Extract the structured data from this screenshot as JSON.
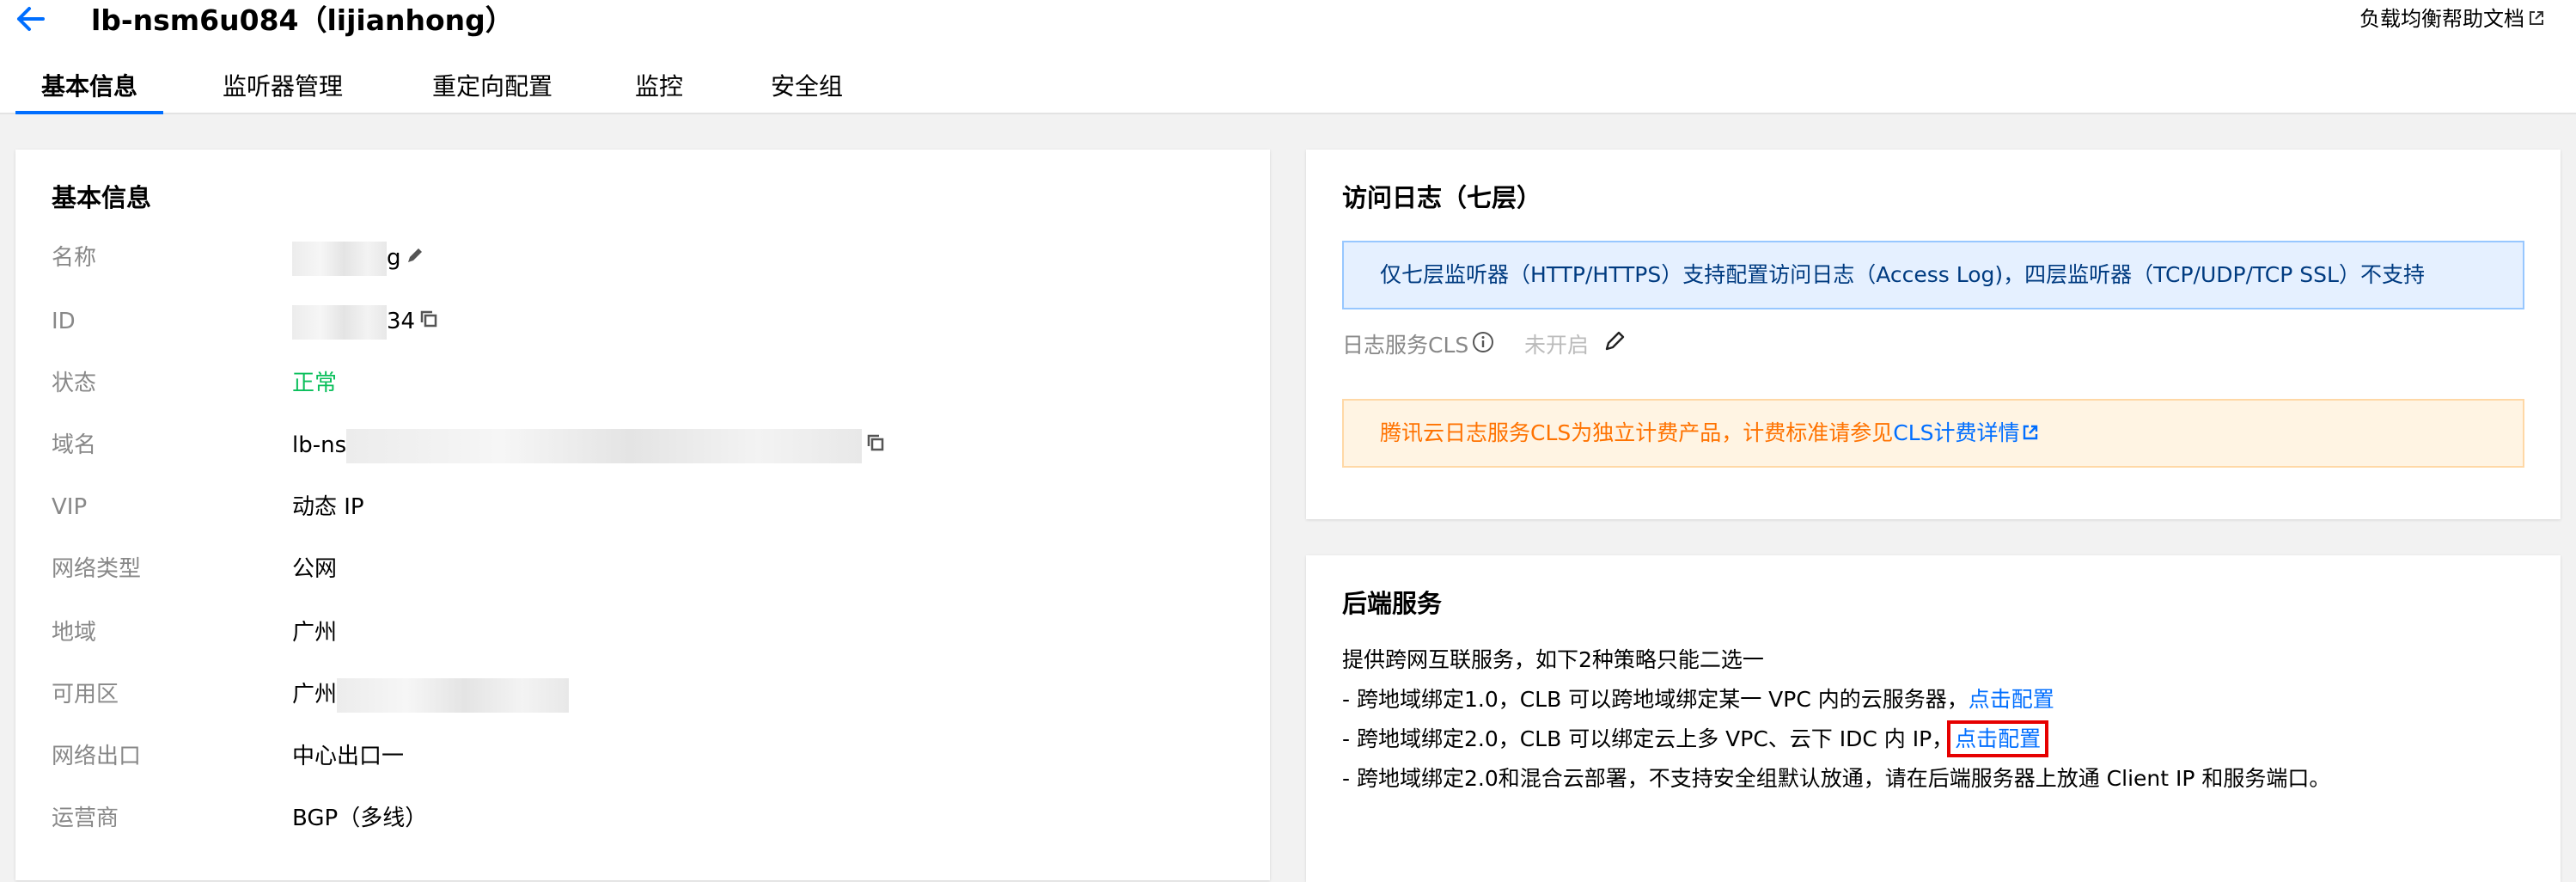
{
  "header": {
    "title": "lb-nsm6u084（lijianhong）",
    "help_label": "负载均衡帮助文档",
    "tabs": [
      {
        "label": "基本信息",
        "active": true
      },
      {
        "label": "监听器管理",
        "active": false
      },
      {
        "label": "重定向配置",
        "active": false
      },
      {
        "label": "监控",
        "active": false
      },
      {
        "label": "安全组",
        "active": false
      }
    ]
  },
  "basic_info": {
    "title": "基本信息",
    "name": {
      "label": "名称",
      "value": "g"
    },
    "id": {
      "label": "ID",
      "value": "34"
    },
    "status": {
      "label": "状态",
      "value": "正常"
    },
    "domain": {
      "label": "域名",
      "value": "lb-ns"
    },
    "vip": {
      "label": "VIP",
      "value": "动态 IP"
    },
    "network_type": {
      "label": "网络类型",
      "value": "公网"
    },
    "region": {
      "label": "地域",
      "value": "广州"
    },
    "zone": {
      "label": "可用区",
      "value": "广州"
    },
    "egress": {
      "label": "网络出口",
      "value": "中心出口一"
    },
    "isp": {
      "label": "运营商",
      "value": "BGP（多线）"
    }
  },
  "access_log": {
    "title": "访问日志（七层）",
    "info": "仅七层监听器（HTTP/HTTPS）支持配置访问日志（Access Log)，四层监听器（TCP/UDP/TCP SSL）不支持",
    "cls_label": "日志服务CLS",
    "cls_state": "未开启",
    "warn_text": "腾讯云日志服务CLS为独立计费产品，计费标准请参见",
    "warn_link": "CLS计费详情"
  },
  "backend": {
    "title": "后端服务",
    "intro": "提供跨网互联服务，如下2种策略只能二选一",
    "line1": "- 跨地域绑定1.0，CLB 可以跨地域绑定某一 VPC 内的云服务器，",
    "line1_link": "点击配置",
    "line2": "- 跨地域绑定2.0，CLB 可以绑定云上多 VPC、云下 IDC 内 IP，",
    "line2_link": "点击配置",
    "line3": "- 跨地域绑定2.0和混合云部署，不支持安全组默认放通，请在后端服务器上放通 Client IP 和服务端口。"
  },
  "colors": {
    "accent": "#006eff",
    "status_ok": "#0abf5b",
    "warning": "#ff7200",
    "highlight": "#e60000"
  }
}
